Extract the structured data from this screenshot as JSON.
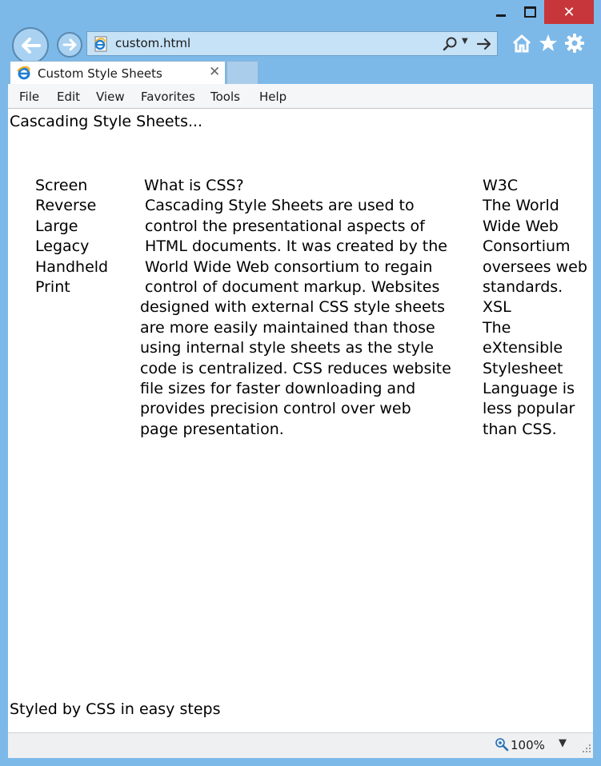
{
  "browser": {
    "address": {
      "url": "custom.html"
    },
    "tab": {
      "title": "Custom Style Sheets"
    },
    "menu": [
      "File",
      "Edit",
      "View",
      "Favorites",
      "Tools",
      "Help"
    ],
    "status": {
      "zoom": "100%"
    },
    "icons": {
      "back": "back-arrow-icon",
      "forward": "forward-arrow-icon",
      "home": "home-icon",
      "favorites": "star-icon",
      "tools": "gear-icon",
      "search": "search-icon",
      "go": "go-arrow-icon"
    },
    "colors": {
      "frame": "#7db9e8",
      "close": "#c7363a"
    }
  },
  "page": {
    "heading": "Cascading Style Sheets...",
    "left_nav": [
      "Screen",
      "Reverse",
      "Large",
      "Legacy",
      "Handheld",
      "Print"
    ],
    "main": {
      "title": "What is CSS?",
      "lines": [
        " Cascading Style Sheets are used to",
        " control the presentational aspects of",
        " HTML documents. It was created by the",
        " World Wide Web consortium to regain",
        " control of document markup. Websites",
        "designed with external CSS style sheets",
        "are more easily maintained than those",
        "using internal style sheets as the style",
        "code is centralized. CSS reduces website",
        "file sizes for faster downloading and",
        "provides precision control over web",
        "page presentation."
      ]
    },
    "sidebar": {
      "w3c_title": "W3C",
      "w3c_lines": [
        "The World",
        "Wide Web",
        "Consortium",
        "oversees web",
        "standards."
      ],
      "xsl_title": "XSL",
      "xsl_lines": [
        "The",
        "eXtensible",
        "Stylesheet",
        "Language is",
        "less popular",
        "than CSS."
      ]
    },
    "footer": "Styled by CSS in easy steps"
  }
}
